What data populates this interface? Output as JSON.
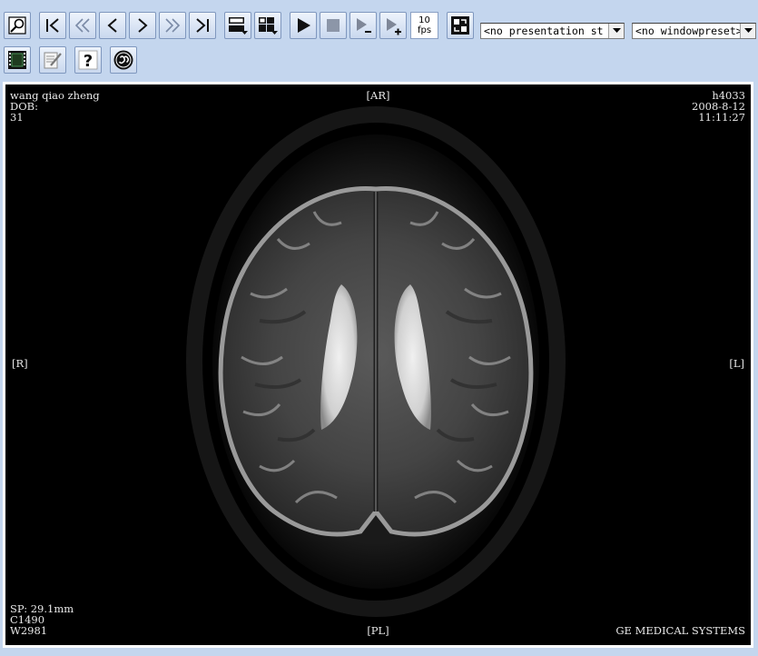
{
  "toolbar": {
    "fps_value": "10",
    "fps_unit": "fps",
    "presentation_select": "<no presentation st",
    "windowpreset_select": "<no windowpreset>"
  },
  "overlay": {
    "patient_name": "wang qiao zheng",
    "dob_label": "DOB:",
    "image_number": "31",
    "top_marker": "[AR]",
    "study_id": "h4033",
    "study_date": "2008-8-12",
    "study_time": "11:11:27",
    "left_marker": "[R]",
    "right_marker": "[L]",
    "slice_position": "SP: 29.1mm",
    "window_center": "C1490",
    "window_width": "W2981",
    "bottom_marker": "[PL]",
    "manufacturer": "GE MEDICAL SYSTEMS"
  },
  "colors": {
    "toolbar_bg": "#c4d6ee",
    "viewer_bg": "#000000",
    "viewer_border": "#ffffff"
  }
}
